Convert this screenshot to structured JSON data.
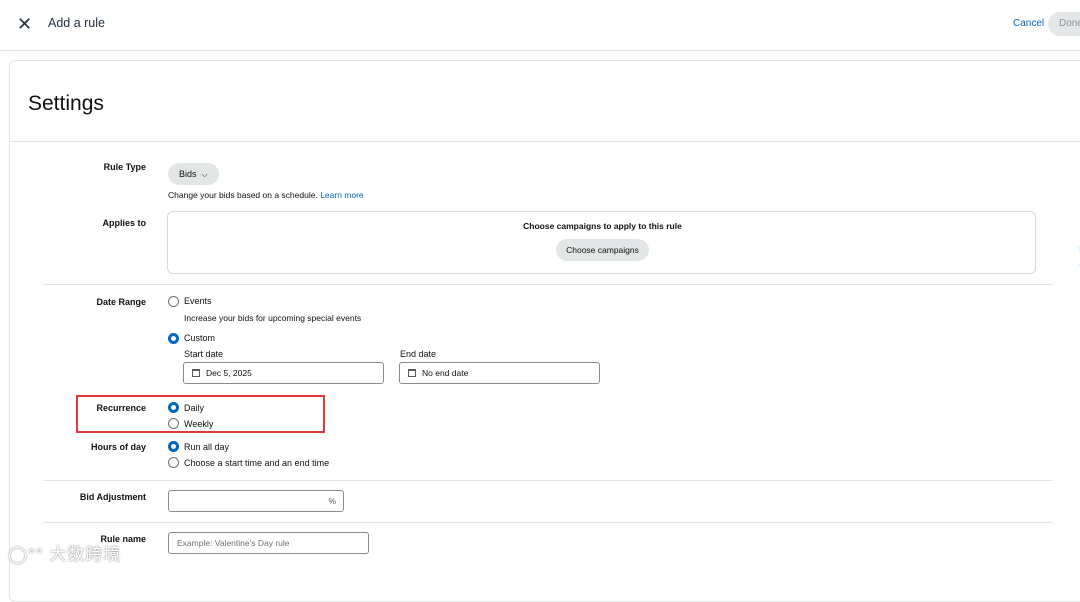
{
  "header": {
    "close_glyph": "✕",
    "title": "Add a rule",
    "cancel_label": "Cancel",
    "done_label": "Done"
  },
  "settings": {
    "title": "Settings",
    "rule_type": {
      "label": "Rule Type",
      "value": "Bids",
      "helper": "Change your bids based on a schedule.",
      "learn_more": "Learn more"
    },
    "applies_to": {
      "label": "Applies to",
      "box_title": "Choose campaigns to apply to this rule",
      "button": "Choose campaigns"
    },
    "date_range": {
      "label": "Date Range",
      "options": [
        {
          "label": "Events",
          "description": "Increase your bids for upcoming special events",
          "checked": false
        },
        {
          "label": "Custom",
          "checked": true
        }
      ],
      "start_label": "Start date",
      "start_value": "Dec 5, 2025",
      "end_label": "End date",
      "end_value": "No end date"
    },
    "recurrence": {
      "label": "Recurrence",
      "options": [
        {
          "label": "Daily",
          "checked": true
        },
        {
          "label": "Weekly",
          "checked": false
        }
      ]
    },
    "hours_of_day": {
      "label": "Hours of day",
      "options": [
        {
          "label": "Run all day",
          "checked": true
        },
        {
          "label": "Choose a start time and an end time",
          "checked": false
        }
      ]
    },
    "bid_adjustment": {
      "label": "Bid Adjustment",
      "unit": "%"
    },
    "rule_name": {
      "label": "Rule name",
      "placeholder": "Example: Valentine's Day rule"
    }
  },
  "watermark": "大数跨境",
  "colors": {
    "accent": "#0066c0",
    "highlight": "#e0393e",
    "button_bg": "#e3e6e6"
  }
}
